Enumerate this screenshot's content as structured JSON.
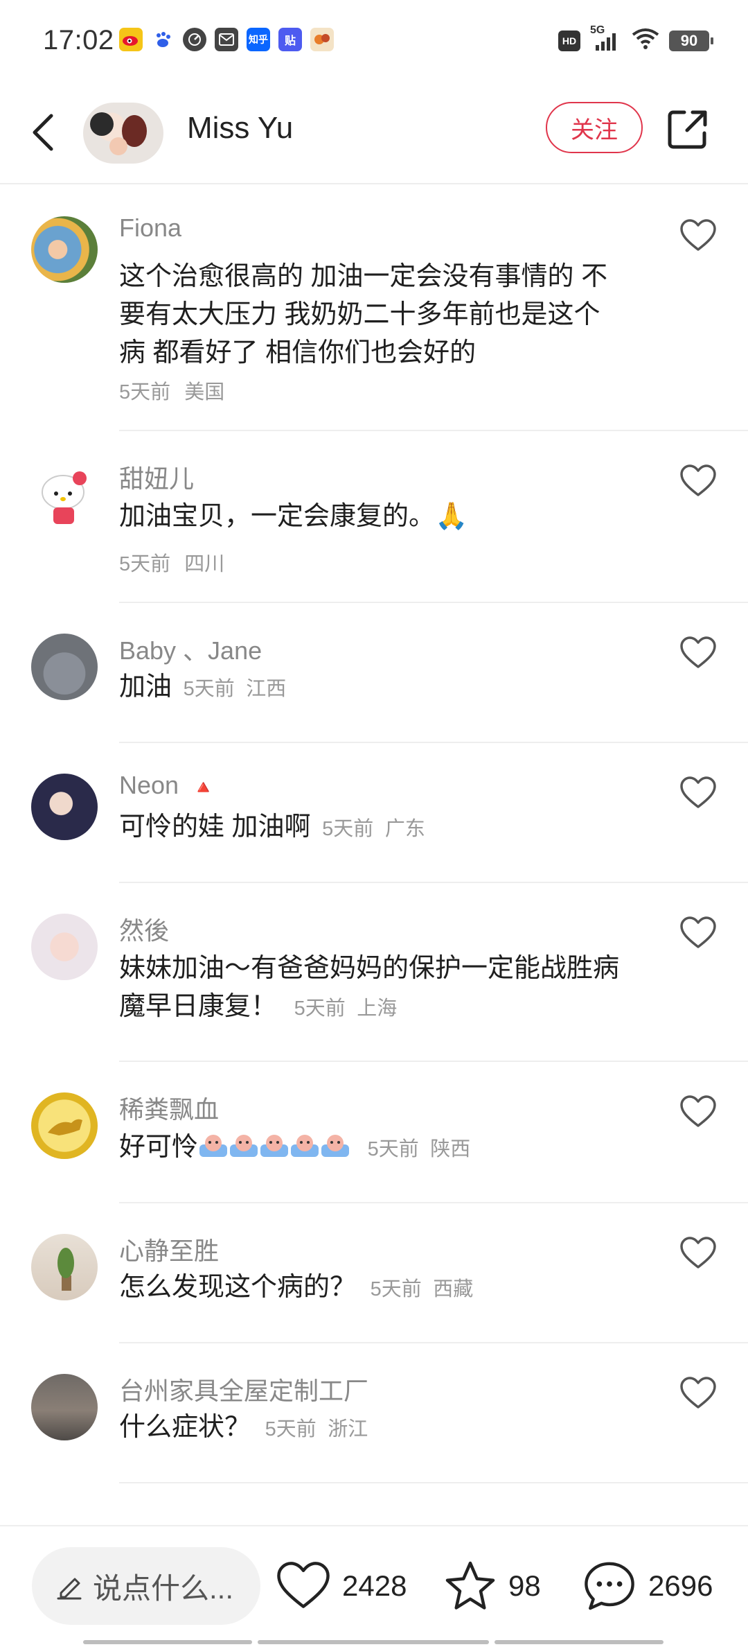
{
  "status_bar": {
    "time": "17:02",
    "notification_icons": [
      "weibo-icon",
      "baidu-icon",
      "speed-icon",
      "mail-icon",
      "zhihu-icon",
      "tieba-icon",
      "game-icon"
    ],
    "notification_labels": [
      "",
      "",
      "",
      "",
      "知乎",
      "贴",
      ""
    ],
    "hd": "HD",
    "network": "5G",
    "battery": "90"
  },
  "header": {
    "username": "Miss Yu",
    "follow_label": "关注"
  },
  "comments": [
    {
      "name": "Fiona",
      "text": "这个治愈很高的 加油一定会没有事情的 不要有太大压力 我奶奶二十多年前也是这个病 都看好了 相信你们也会好的",
      "time": "5天前",
      "location": "美国"
    },
    {
      "name": "甜妞儿",
      "text": "加油宝贝，一定会康复的。",
      "emoji": "🙏",
      "time": "5天前",
      "location": "四川"
    },
    {
      "name": "Baby 、Jane",
      "text": "加油",
      "time": "5天前",
      "location": "江西"
    },
    {
      "name": "Neon",
      "name_badge": "🔺",
      "text": "可怜的娃 加油啊",
      "time": "5天前",
      "location": "广东"
    },
    {
      "name": "然後",
      "text": "妹妹加油～有爸爸妈妈的保护一定能战胜病魔早日康复！",
      "time": "5天前",
      "location": "上海"
    },
    {
      "name": "稀粪飘血",
      "text": "好可怜",
      "emoji_count": 5,
      "time": "5天前",
      "location": "陕西"
    },
    {
      "name": "心静至胜",
      "text": "怎么发现这个病的？",
      "time": "5天前",
      "location": "西藏"
    },
    {
      "name": "台州家具全屋定制工厂",
      "text": "什么症状？",
      "time": "5天前",
      "location": "浙江"
    }
  ],
  "bottom_bar": {
    "input_placeholder": "说点什么...",
    "likes": "2428",
    "favorites": "98",
    "comments": "2696"
  },
  "colors": {
    "accent": "#e0354b",
    "text_primary": "#1f1f1f",
    "text_secondary": "#888888"
  }
}
